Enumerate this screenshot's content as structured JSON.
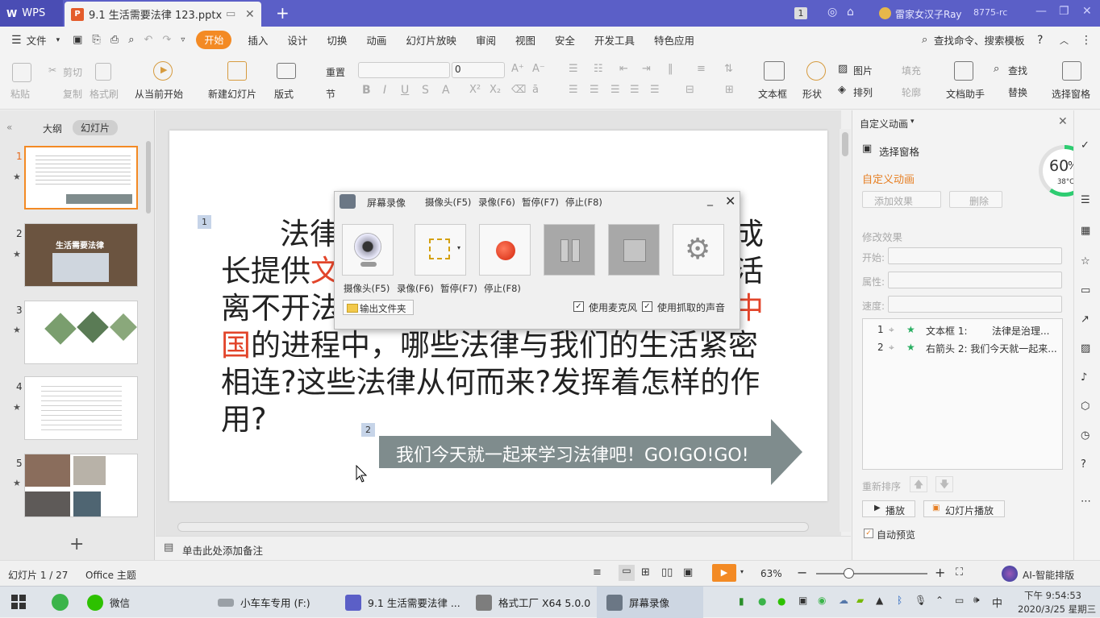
{
  "titlebar": {
    "app_tab": "WPS",
    "doc_tab": "9.1 生活需要法律 123.pptx",
    "badge": "1",
    "user": "雷家女汉子Ray",
    "user_id": "8775-rc"
  },
  "menubar": {
    "file": "文件",
    "tabs": [
      "开始",
      "插入",
      "设计",
      "切换",
      "动画",
      "幻灯片放映",
      "审阅",
      "视图",
      "安全",
      "开发工具",
      "特色应用"
    ],
    "search": "查找命令、搜索模板"
  },
  "ribbon": {
    "paste": "粘贴",
    "cut": "剪切",
    "copy": "复制",
    "format_painter": "格式刷",
    "from_current": "从当前开始",
    "new_slide": "新建幻灯片",
    "layout": "版式",
    "reset": "重置",
    "section": "节",
    "font_size": "0",
    "textbox": "文本框",
    "shape": "形状",
    "picture": "图片",
    "fill": "填充",
    "arrange": "排列",
    "outline": "轮廓",
    "find": "查找",
    "replace": "替换",
    "doc_assistant": "文档助手",
    "select_pane": "选择窗格"
  },
  "leftpanel": {
    "tab_outline": "大纲",
    "tab_slides": "幻灯片",
    "thumbs": [
      {
        "num": "1"
      },
      {
        "num": "2",
        "title": "生活需要法律"
      },
      {
        "num": "3"
      },
      {
        "num": "4"
      },
      {
        "num": "5"
      }
    ]
  },
  "slide": {
    "marker1": "1",
    "marker2": "2",
    "line1a": "法律",
    "line1b": "成",
    "line2a": "长提供",
    "line2b": "文",
    "line2c": "活",
    "line3a": "离不开法",
    "line3b": "中",
    "line4a": "国",
    "line4b": "的进程中，哪些法律与我们的生活紧密",
    "line5": "相连?这些法律从何而来?发挥着怎样的作",
    "line6": "用?",
    "arrow_text": "我们今天就一起来学习法律吧！GO!GO!GO!"
  },
  "notes": {
    "placeholder": "单击此处添加备注"
  },
  "recorder": {
    "title": "屏幕录像",
    "hotkeys": [
      "摄像头(F5)",
      "录像(F6)",
      "暂停(F7)",
      "停止(F8)"
    ],
    "labels": [
      "摄像头(F5)",
      "录像(F6)",
      "暂停(F7)",
      "停止(F8)"
    ],
    "output_folder": "输出文件夹",
    "use_mic": "使用麦克风",
    "use_capture_sound": "使用抓取的声音"
  },
  "rightpanel": {
    "header": "自定义动画",
    "select_pane": "选择窗格",
    "section_title": "自定义动画",
    "add_effect": "添加效果",
    "delete": "删除",
    "modify": "修改效果",
    "start_label": "开始:",
    "property_label": "属性:",
    "speed_label": "速度:",
    "anim_items": [
      {
        "num": "1",
        "text": "文本框 1:",
        "detail": "法律是治理..."
      },
      {
        "num": "2",
        "text": "右箭头 2: 我们今天就一起来..."
      }
    ],
    "reorder": "重新排序",
    "play": "播放",
    "slideshow": "幻灯片播放",
    "auto_preview": "自动预览",
    "gauge_pct": "60",
    "gauge_unit": "%",
    "gauge_temp": "38°C"
  },
  "statusbar": {
    "slide_info": "幻灯片 1 / 27",
    "theme": "Office 主题",
    "zoom": "63%",
    "ai": "AI-智能排版"
  },
  "taskbar": {
    "items": [
      "微信",
      "小车车专用 (F:)",
      "9.1 生活需要法律 ...",
      "格式工厂 X64 5.0.0",
      "屏幕录像"
    ],
    "ime": "中",
    "time": "下午 9:54:53",
    "date": "2020/3/25 星期三"
  },
  "colors": {
    "titlebar": "#5b5fc7",
    "accent": "#f38a24",
    "red_text": "#e2452b",
    "arrow": "#7f8c8d",
    "gauge": "#2ecc71"
  }
}
